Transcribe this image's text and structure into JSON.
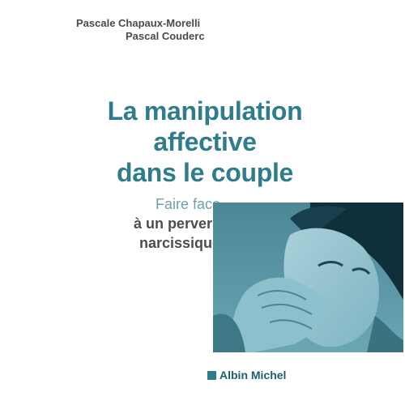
{
  "book": {
    "authors": [
      "Pascale Chapaux-Morelli",
      "Pascal Couderc"
    ],
    "title_lines": [
      "La manipulation",
      "affective",
      "dans le couple"
    ],
    "subtitle_lines": [
      "Faire face",
      "à un pervers",
      "narcissique"
    ],
    "publisher": "Albin Michel"
  },
  "colors": {
    "title": "#2f7c8c",
    "subtitle_accent": "#6f9fab",
    "photo_tint": "#4b8796",
    "publisher": "#1d5f6e"
  }
}
